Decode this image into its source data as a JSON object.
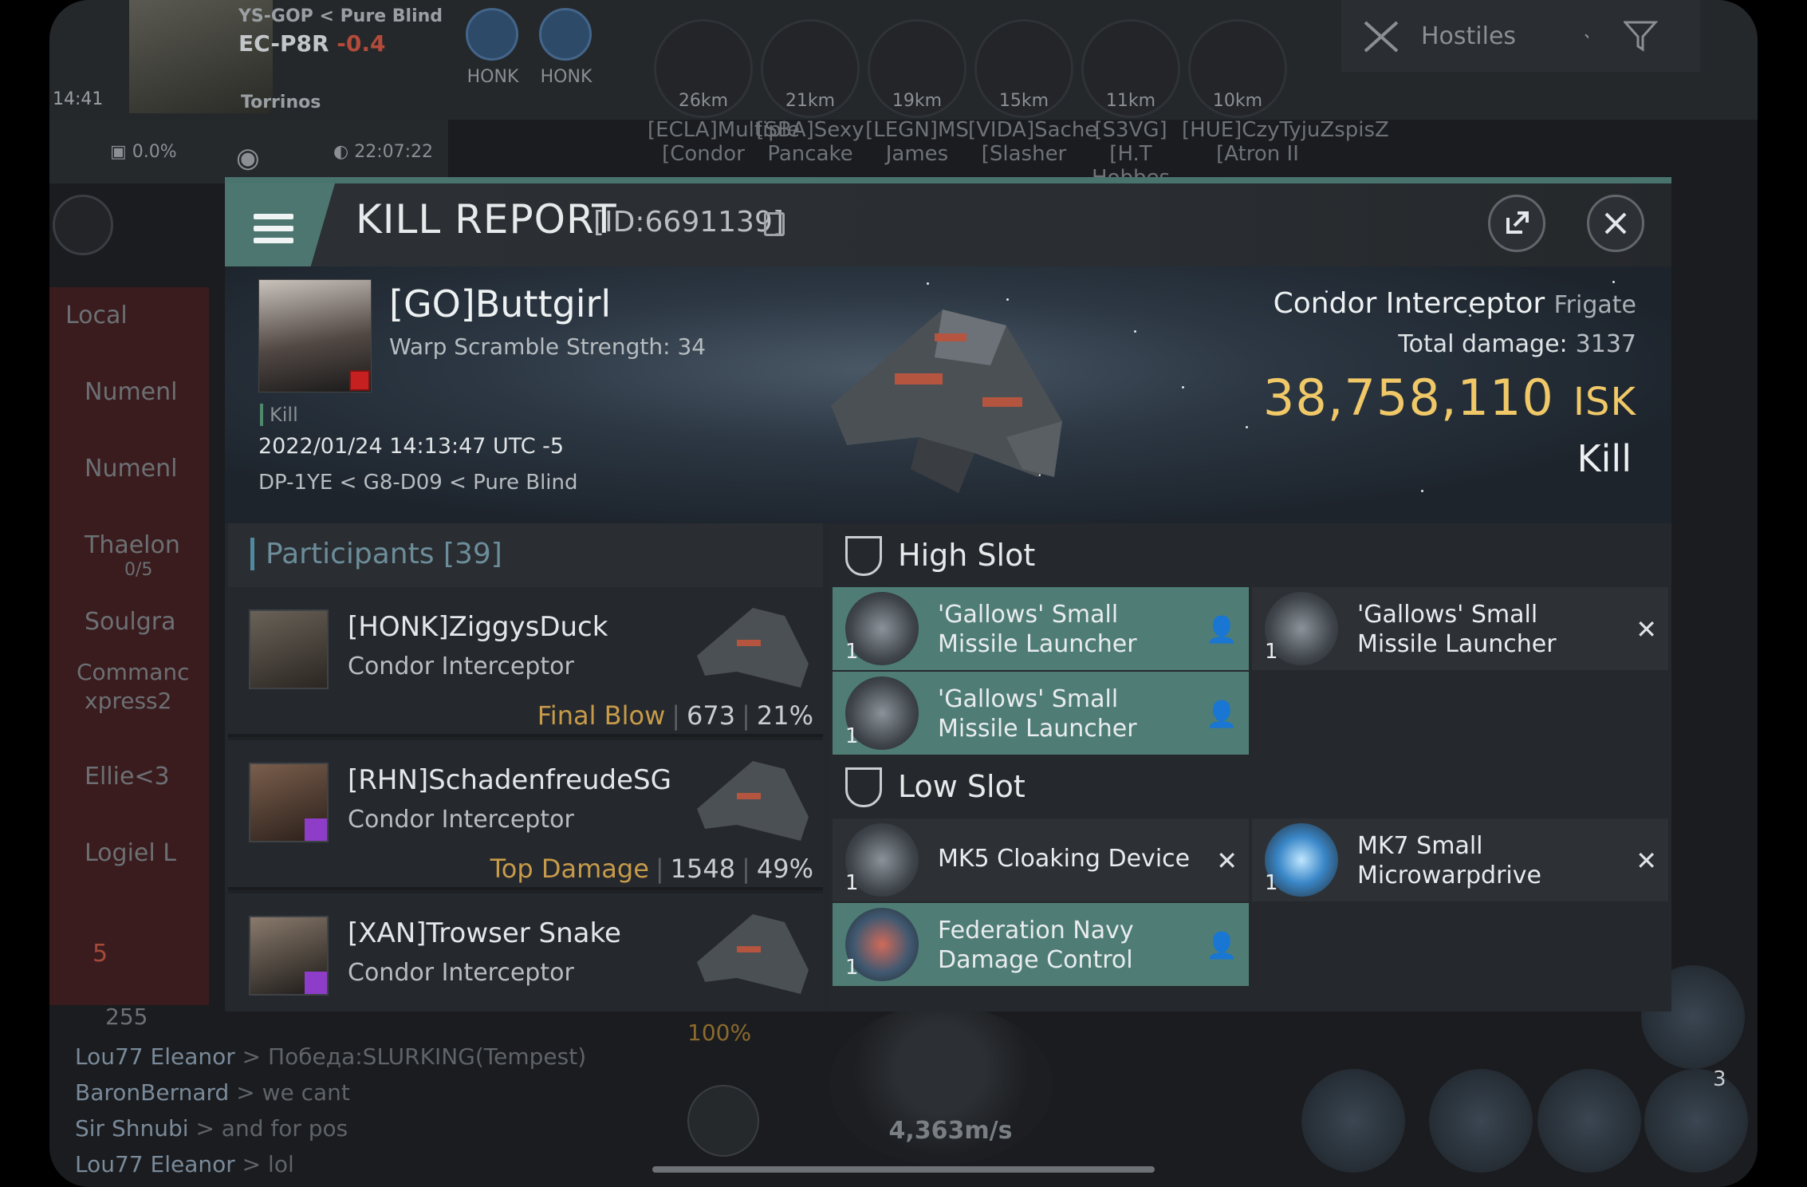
{
  "hud": {
    "corp_tag": "YS-GOP",
    "region": "Pure Blind",
    "system": "EC-P8R",
    "security": "-0.4",
    "time": "14:41",
    "pilot": "Torrinos",
    "fleet": [
      {
        "label": "HONK"
      },
      {
        "label": "HONK"
      }
    ],
    "targets": [
      {
        "dist": "26km",
        "name1": "[ECLA]Multiple",
        "name2": "[Condor"
      },
      {
        "dist": "21km",
        "name1": "[SBA]Sexy",
        "name2": "Pancake"
      },
      {
        "dist": "19km",
        "name1": "[LEGN]MS",
        "name2": "James"
      },
      {
        "dist": "15km",
        "name1": "[VIDA]Sache",
        "name2": "[Slasher"
      },
      {
        "dist": "11km",
        "name1": "[S3VG][H.T",
        "name2": "Hobbes"
      },
      {
        "dist": "10km",
        "name1": "[HUE]CzyTyjuZspisZ",
        "name2": "[Atron II"
      }
    ],
    "hostiles_label": "Hostiles",
    "cargo": "0.0%",
    "clock": "22:07:22",
    "local_label": "Local",
    "local_members": [
      "Numenl",
      "Numenl",
      "Thaelon",
      "0/5",
      "Soulgra",
      "Commanc",
      "xpress2",
      "Ellie<3",
      "Logiel L",
      "5"
    ],
    "local_count": "255",
    "speed": "4,363m/s",
    "throttle": "100%",
    "module_count": "3",
    "chat": [
      {
        "name": "Lou77 Eleanor",
        "msg": "> Победа:SLURKING(Tempest)"
      },
      {
        "name": "BaronBernard",
        "msg": "> we cant"
      },
      {
        "name": "Sir Shnubi",
        "msg": "> and for pos"
      },
      {
        "name": "Lou77 Eleanor",
        "msg": "> lol"
      }
    ]
  },
  "report": {
    "title": "KILL REPORT",
    "id": "[ID:6691139]",
    "victim": {
      "name": "[GO]Buttgirl",
      "scram": "Warp Scramble Strength: 34",
      "tag": "Kill",
      "date": "2022/01/24 14:13:47 UTC -5",
      "location": "DP-1YE < G8-D09 < Pure Blind"
    },
    "ship": {
      "name": "Condor Interceptor",
      "class": "Frigate",
      "damage_label": "Total damage:",
      "damage": "3137",
      "isk": "38,758,110",
      "isk_unit": "ISK",
      "result": "Kill"
    },
    "participants_title": "Participants",
    "participants_count": "[39]",
    "participants": [
      {
        "name": "[HONK]ZiggysDuck",
        "ship": "Condor Interceptor",
        "label": "Final Blow",
        "damage": "673",
        "pct": "21%"
      },
      {
        "name": "[RHN]SchadenfreudeSG",
        "ship": "Condor Interceptor",
        "label": "Top Damage",
        "damage": "1548",
        "pct": "49%"
      },
      {
        "name": "[XAN]Trowser Snake",
        "ship": "Condor Interceptor",
        "label": "",
        "damage": "",
        "pct": ""
      }
    ],
    "high_slot_title": "High Slot",
    "low_slot_title": "Low Slot",
    "high_slots": [
      {
        "name1": "'Gallows' Small",
        "name2": "Missile Launcher",
        "qty": "1",
        "dropped": true
      },
      {
        "name1": "'Gallows' Small",
        "name2": "Missile Launcher",
        "qty": "1",
        "dropped": false
      },
      {
        "name1": "'Gallows' Small",
        "name2": "Missile Launcher",
        "qty": "1",
        "dropped": true
      }
    ],
    "low_slots": [
      {
        "name1": "MK5 Cloaking Device",
        "name2": "",
        "qty": "1",
        "dropped": false
      },
      {
        "name1": "MK7 Small",
        "name2": "Microwarpdrive",
        "qty": "1",
        "dropped": false
      },
      {
        "name1": "Federation Navy",
        "name2": "Damage Control",
        "qty": "1",
        "dropped": true
      }
    ],
    "colors": {
      "accent": "#4f7d76",
      "isk": "#f0c867",
      "final_blow": "#c79b4a"
    }
  }
}
